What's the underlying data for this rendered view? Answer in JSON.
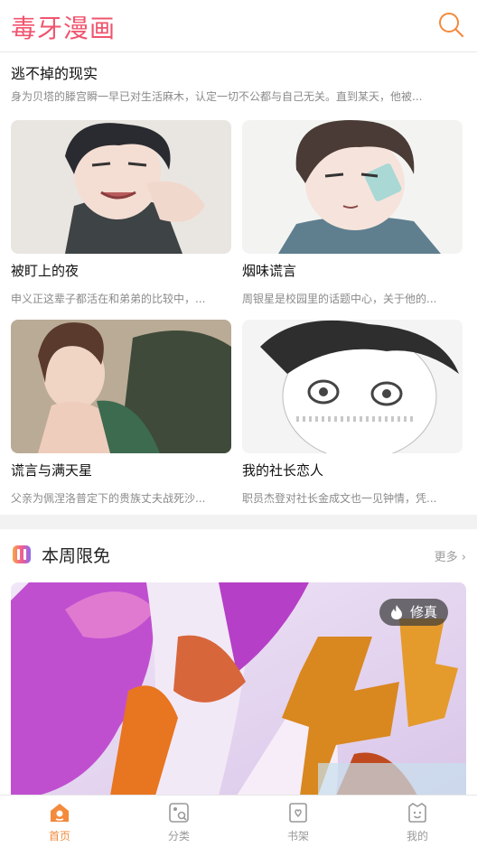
{
  "app": {
    "brand": "毒牙漫画"
  },
  "featured": {
    "title": "逃不掉的现实",
    "description": "身为贝塔的滕宫瞬一早已对生活麻木，认定一切不公都与自己无关。直到某天，他被..."
  },
  "comics": [
    {
      "name": "被盯上的夜",
      "summary": "申义正这辈子都活在和弟弟的比较中，..."
    },
    {
      "name": "烟味谎言",
      "summary": "周银星是校园里的话题中心，关于他的..."
    },
    {
      "name": "谎言与满天星",
      "summary": "父亲为佩涅洛普定下的贵族丈夫战死沙..."
    },
    {
      "name": "我的社长恋人",
      "summary": "职员杰登对社长金成文也一见钟情，凭..."
    }
  ],
  "weekly_free": {
    "title": "本周限免",
    "more": "更多 ›",
    "banner": {
      "tag": "修真",
      "tag_icon": "fire-icon"
    }
  },
  "tabbar": {
    "items": [
      {
        "label": "首页",
        "icon": "home-icon",
        "active": true
      },
      {
        "label": "分类",
        "icon": "category-icon",
        "active": false
      },
      {
        "label": "书架",
        "icon": "bookshelf-icon",
        "active": false
      },
      {
        "label": "我的",
        "icon": "profile-icon",
        "active": false
      }
    ]
  },
  "colors": {
    "brand": "#f0546e",
    "accent": "#f38a3c",
    "muted": "#8a8a8a"
  }
}
